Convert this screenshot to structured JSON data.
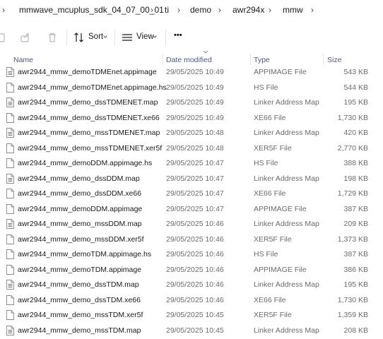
{
  "breadcrumb": {
    "items": [
      "mmwave_mcuplus_sdk_04_07_00_01",
      "ti",
      "demo",
      "awr294x",
      "mmw"
    ],
    "separator": "›"
  },
  "toolbar": {
    "sort_label": "Sort",
    "view_label": "View",
    "more_label": "•••"
  },
  "columns": {
    "name": "Name",
    "date": "Date modified",
    "type": "Type",
    "size": "Size"
  },
  "files": [
    {
      "name": "awr2944_mmw_demoTDMEnet.appimage",
      "date": "29/05/2025 10:49",
      "type": "APPIMAGE File",
      "size": "543 KB",
      "icon": "binary-file-icon"
    },
    {
      "name": "awr2944_mmw_demoTDMEnet.appimage.hs",
      "date": "29/05/2025 10:49",
      "type": "HS File",
      "size": "544 KB",
      "icon": "blank-file-icon"
    },
    {
      "name": "awr2944_mmw_demo_dssTDMENET.map",
      "date": "29/05/2025 10:49",
      "type": "Linker Address Map",
      "size": "195 KB",
      "icon": "map-file-icon"
    },
    {
      "name": "awr2944_mmw_demo_dssTDMENET.xe66",
      "date": "29/05/2025 10:49",
      "type": "XE66 File",
      "size": "1,730 KB",
      "icon": "blank-file-icon"
    },
    {
      "name": "awr2944_mmw_demo_mssTDMENET.map",
      "date": "29/05/2025 10:48",
      "type": "Linker Address Map",
      "size": "420 KB",
      "icon": "map-file-icon"
    },
    {
      "name": "awr2944_mmw_demo_mssTDMENET.xer5f",
      "date": "29/05/2025 10:48",
      "type": "XER5F File",
      "size": "2,770 KB",
      "icon": "blank-file-icon"
    },
    {
      "name": "awr2944_mmw_demoDDM.appimage.hs",
      "date": "29/05/2025 10:47",
      "type": "HS File",
      "size": "388 KB",
      "icon": "blank-file-icon"
    },
    {
      "name": "awr2944_mmw_demo_dssDDM.map",
      "date": "29/05/2025 10:47",
      "type": "Linker Address Map",
      "size": "198 KB",
      "icon": "map-file-icon"
    },
    {
      "name": "awr2944_mmw_demo_dssDDM.xe66",
      "date": "29/05/2025 10:47",
      "type": "XE66 File",
      "size": "1,729 KB",
      "icon": "blank-file-icon"
    },
    {
      "name": "awr2944_mmw_demoDDM.appimage",
      "date": "29/05/2025 10:47",
      "type": "APPIMAGE File",
      "size": "387 KB",
      "icon": "blank-file-icon"
    },
    {
      "name": "awr2944_mmw_demo_mssDDM.map",
      "date": "29/05/2025 10:46",
      "type": "Linker Address Map",
      "size": "209 KB",
      "icon": "map-file-icon"
    },
    {
      "name": "awr2944_mmw_demo_mssDDM.xer5f",
      "date": "29/05/2025 10:46",
      "type": "XER5F File",
      "size": "1,373 KB",
      "icon": "blank-file-icon"
    },
    {
      "name": "awr2944_mmw_demoTDM.appimage.hs",
      "date": "29/05/2025 10:46",
      "type": "HS File",
      "size": "387 KB",
      "icon": "blank-file-icon"
    },
    {
      "name": "awr2944_mmw_demoTDM.appimage",
      "date": "29/05/2025 10:46",
      "type": "APPIMAGE File",
      "size": "386 KB",
      "icon": "blank-file-icon"
    },
    {
      "name": "awr2944_mmw_demo_dssTDM.map",
      "date": "29/05/2025 10:46",
      "type": "Linker Address Map",
      "size": "195 KB",
      "icon": "map-file-icon"
    },
    {
      "name": "awr2944_mmw_demo_dssTDM.xe66",
      "date": "29/05/2025 10:46",
      "type": "XE66 File",
      "size": "1,730 KB",
      "icon": "blank-file-icon"
    },
    {
      "name": "awr2944_mmw_demo_mssTDM.xer5f",
      "date": "29/05/2025 10:45",
      "type": "XER5F File",
      "size": "1,359 KB",
      "icon": "blank-file-icon"
    },
    {
      "name": "awr2944_mmw_demo_mssTDM.map",
      "date": "29/05/2025 10:45",
      "type": "Linker Address Map",
      "size": "208 KB",
      "icon": "map-file-icon"
    }
  ]
}
